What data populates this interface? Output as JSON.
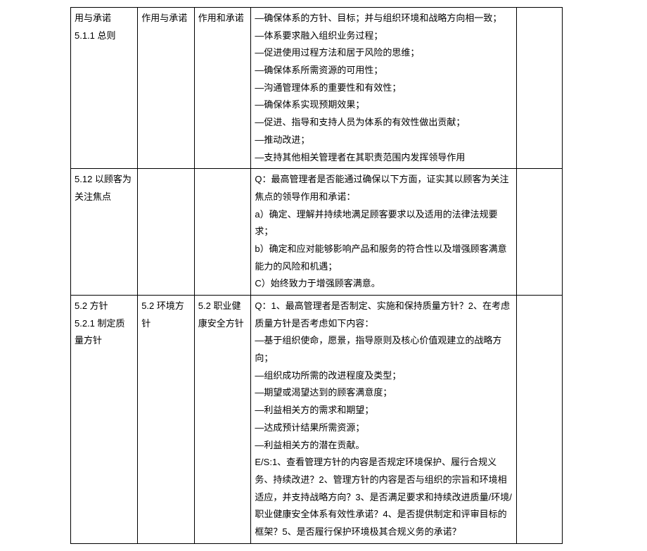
{
  "rows": [
    {
      "c1": "用与承诺\n5.1.1 总则",
      "c2": "作用与承诺",
      "c3": "作用和承诺",
      "c4": "—确保体系的方针、目标；并与组织环境和战略方向相一致；\n—体系要求融入组织业务过程；\n—促进使用过程方法和居于风险的思维；\n—确保体系所需资源的可用性；\n—沟通管理体系的重要性和有效性；\n—确保体系实现预期效果；\n—促进、指导和支持人员为体系的有效性做出贡献；\n—推动改进；\n—支持其他相关管理者在其职责范围内发挥领导作用",
      "c5": ""
    },
    {
      "c1": "5.12 以顾客为关注焦点",
      "c2": "",
      "c3": "",
      "c4": "Q：最高管理者是否能通过确保以下方面，证实其以顾客为关注焦点的领导作用和承诺：\na）确定、理解并持续地满足顾客要求以及适用的法律法规要求；\nb）确定和应对能够影响产品和服务的符合性以及增强顾客满意能力的风险和机遇；\nC）始终致力于增强顾客满意。",
      "c5": ""
    },
    {
      "c1": "5.2 方针\n5.2.1 制定质量方针",
      "c2": "5.2 环境方针",
      "c3": "5.2 职业健康安全方针",
      "c4": "Q：1、最高管理者是否制定、实施和保持质量方针？2、在考虑质量方针是否考虑如下内容：\n—基于组织使命，愿景，指导原则及核心价值观建立的战略方向；\n—组织成功所需的改进程度及类型；\n—期望或渴望达到的顾客满意度；\n—利益相关方的需求和期望；\n—达成预计结果所需资源；\n—利益相关方的潜在贡献。\nE/S:1、查看管理方针的内容是否规定环境保护、履行合规义务、持续改进？2、管理方针的内容是否与组织的宗旨和环境相适应，并支持战略方向？3、是否满足要求和持续改进质量/环境/职业健康安全体系有效性承诺？4、是否提供制定和评审目标的框架？5、是否履行保护环境极其合规义务的承诺？",
      "c5": ""
    }
  ]
}
